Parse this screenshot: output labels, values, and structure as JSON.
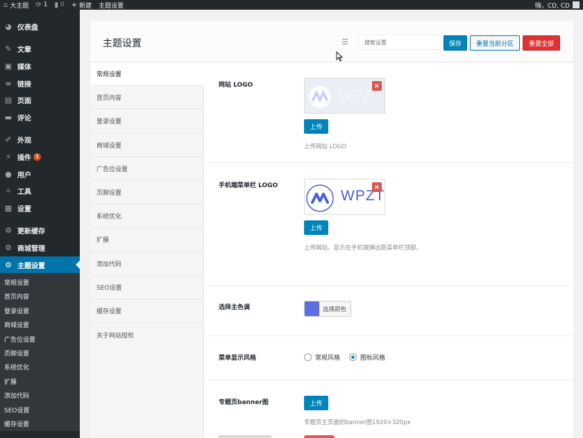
{
  "adminbar": {
    "site_name": "大主题",
    "updates_count": "1",
    "comments_count": "0",
    "new_label": "新建",
    "theme_settings_label": "主题设置",
    "greeting": "嗨，CD, CD"
  },
  "sidebar": {
    "dashboard": "仪表盘",
    "posts": "文章",
    "media": "媒体",
    "links": "链接",
    "pages": "页面",
    "comments": "评论",
    "appearance": "外观",
    "plugins": "插件",
    "plugins_badge": "1",
    "users": "用户",
    "tools": "工具",
    "settings": "设置",
    "update_cache": "更新缓存",
    "shop_manage": "商城管理",
    "theme_settings": "主题设置",
    "submenu": [
      "常规设置",
      "首页内容",
      "登录设置",
      "商城设置",
      "广告位设置",
      "页脚设置",
      "系统优化",
      "扩展",
      "添加代码",
      "SEO设置",
      "缓存设置"
    ]
  },
  "panel": {
    "title": "主题设置",
    "search_placeholder": "搜索设置",
    "save_label": "保存",
    "reset_section_label": "重置当前分区",
    "reset_all_label": "重置全部"
  },
  "tabs": [
    "常规设置",
    "首页内容",
    "登录设置",
    "商城设置",
    "广告位设置",
    "页脚设置",
    "系统优化",
    "扩展",
    "添加代码",
    "SEO设置",
    "缓存设置",
    "关于网站授权"
  ],
  "fields": {
    "site_logo": {
      "label": "网站 LOGO",
      "logo_text": "WPZT",
      "upload_label": "上传",
      "desc": "上传网站 LOGO"
    },
    "mobile_logo": {
      "label": "手机端菜单栏 LOGO",
      "logo_text": "WPZT",
      "upload_label": "上传",
      "desc": "上传网站，显示在手机端弹出层菜单栏顶部。"
    },
    "main_color": {
      "label": "选择主色调",
      "color": "#5b6fe0",
      "button_text": "选择颜色"
    },
    "menu_style": {
      "label": "菜单显示风格",
      "options": [
        "常规风格",
        "图标风格"
      ],
      "selected": "图标风格"
    },
    "topic_banner": {
      "label": "专题页banner图",
      "upload_label": "上传",
      "desc": "专题页主页面的banner图1920×320px"
    }
  },
  "colors": {
    "adminbar_bg": "#23282d",
    "accent": "#0073aa",
    "primary_button": "#0085ba",
    "danger": "#dd3333",
    "logo_blue": "#4a5fdc"
  }
}
